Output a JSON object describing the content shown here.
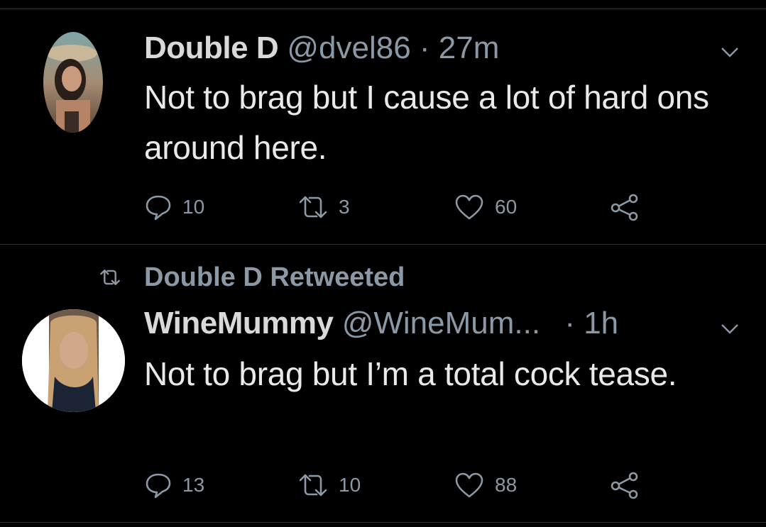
{
  "tweets": [
    {
      "display_name": "Double D",
      "handle": "@dvel86",
      "separator": "·",
      "time": "27m",
      "text": "Not to brag but I cause a lot of hard ons around here.",
      "replies": "10",
      "retweets": "3",
      "likes": "60"
    },
    {
      "retweet_label": "Double D Retweeted",
      "display_name": "WineMummy",
      "handle": "@WineMum...",
      "separator": "·",
      "time": "1h",
      "text": "Not to brag but I’m a total cock tease.",
      "replies": "13",
      "retweets": "10",
      "likes": "88"
    }
  ],
  "icons": {
    "reply": "reply-icon",
    "retweet": "retweet-icon",
    "like": "heart-icon",
    "share": "share-icon",
    "menu": "chevron-down-icon"
  },
  "colors": {
    "background": "#000000",
    "text": "#e7e9ea",
    "muted": "#8b98a5",
    "divider": "#2f3336"
  }
}
